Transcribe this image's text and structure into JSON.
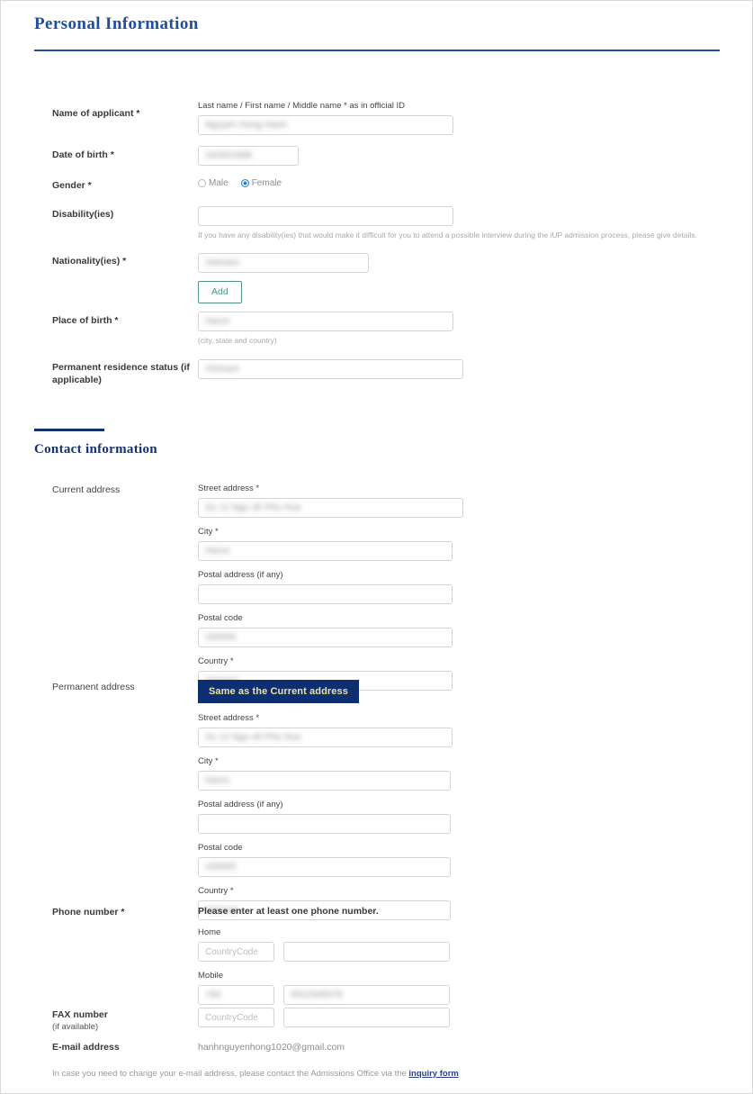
{
  "sections": {
    "personal": {
      "title": "Personal Information",
      "fields": {
        "name": {
          "label": "Name of applicant *",
          "sublabel": "Last name / First name / Middle name * as in official ID",
          "value": "Nguyen Hong Hanh",
          "redacted": true
        },
        "dob": {
          "label": "Date of birth *",
          "value": "10/20/1998",
          "redacted": true
        },
        "gender": {
          "label": "Gender *",
          "options": [
            "Male",
            "Female"
          ],
          "selected": "Female"
        },
        "disability": {
          "label": "Disability(ies)",
          "value": "",
          "helper": "If you have any disability(ies) that would make it difficult for you to attend a possible interview during the iUP admission process, please give details."
        },
        "nationality": {
          "label": "Nationality(ies) *",
          "value": "Vietnam",
          "redacted": true,
          "add_button": "Add"
        },
        "place_of_birth": {
          "label": "Place of birth *",
          "value": "Hanoi",
          "redacted": true,
          "helper": "(city, state and country)"
        },
        "permanent_residence": {
          "label": "Permanent residence status (if applicable)",
          "value": "Vietnam",
          "redacted": true
        }
      }
    },
    "contact": {
      "title": "Contact information",
      "current_address": {
        "label": "Current address",
        "fields": [
          {
            "sublabel": "Street address *",
            "value": "So 12 Ngo 45 Pho Hue",
            "redacted": true
          },
          {
            "sublabel": "City *",
            "value": "Hanoi",
            "redacted": true
          },
          {
            "sublabel": "Postal address (if any)",
            "value": "",
            "redacted": false
          },
          {
            "sublabel": "Postal code",
            "value": "100000",
            "redacted": true
          },
          {
            "sublabel": "Country *",
            "value": "Vietnam",
            "redacted": true
          }
        ]
      },
      "permanent_address": {
        "label": "Permanent address",
        "same_as_current_button": "Same as the Current address",
        "fields": [
          {
            "sublabel": "Street address *",
            "value": "So 12 Ngo 45 Pho Hue",
            "redacted": true
          },
          {
            "sublabel": "City *",
            "value": "Hanoi",
            "redacted": true
          },
          {
            "sublabel": "Postal address (if any)",
            "value": "",
            "redacted": false
          },
          {
            "sublabel": "Postal code",
            "value": "100000",
            "redacted": true
          },
          {
            "sublabel": "Country *",
            "value": "Vietnam",
            "redacted": true
          }
        ]
      },
      "phone": {
        "label": "Phone number *",
        "note": "Please enter at least one phone number.",
        "home": {
          "sublabel": "Home",
          "country_code_placeholder": "CountryCode",
          "country_code_value": "",
          "number_value": ""
        },
        "mobile": {
          "sublabel": "Mobile",
          "country_code_placeholder": "",
          "country_code_value": "+84",
          "country_code_redacted": true,
          "number_value": "0912345678",
          "number_redacted": true
        }
      },
      "fax": {
        "label": "FAX number",
        "sublabel": "(if available)",
        "country_code_placeholder": "CountryCode",
        "country_code_value": "",
        "number_value": ""
      },
      "email": {
        "label": "E-mail address",
        "value": "hanhnguyenhong1020@gmail.com"
      },
      "footnote": {
        "text_before": "In case you need to change your e-mail address, please contact the Admissions Office via the ",
        "link": "inquiry form"
      }
    }
  },
  "colors": {
    "heading_blue": "#1f4e9c",
    "subheading_navy": "#14306e",
    "button_navy": "#0d2f72",
    "button_navy_text": "#e9e2a0",
    "add_button_teal": "#4f9487",
    "radio_selected_blue": "#2a7fd4",
    "link_blue": "#2a3f8f"
  }
}
